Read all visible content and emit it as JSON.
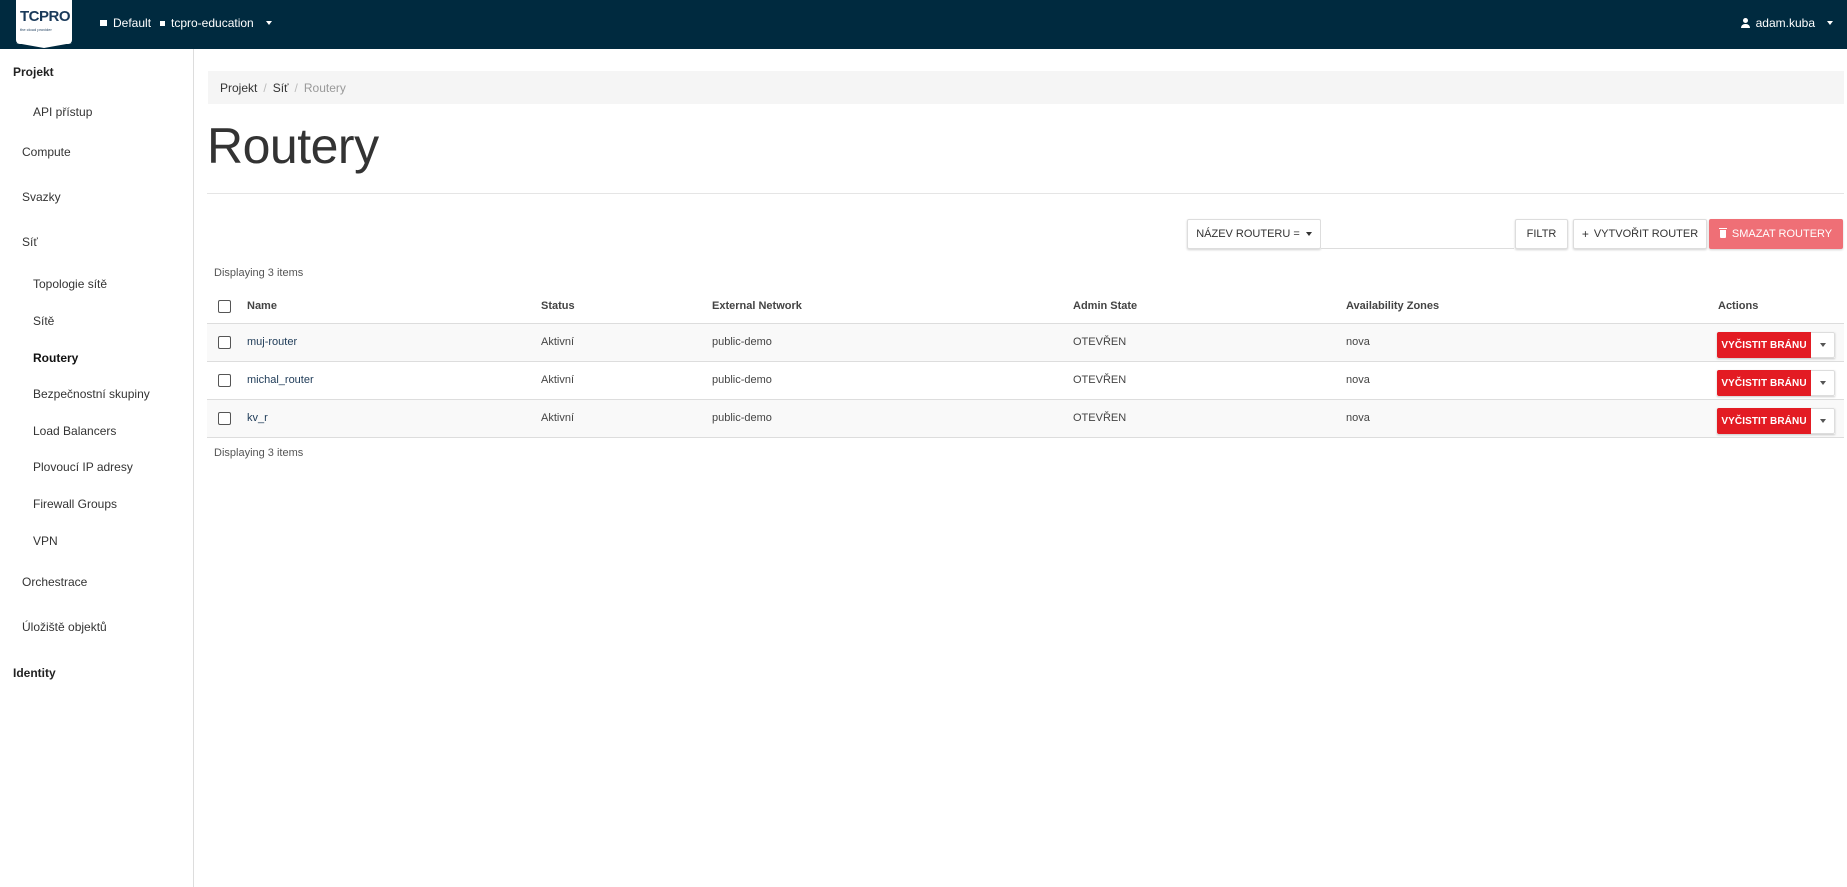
{
  "colors": {
    "topbar": "#002a3f",
    "danger": "#e31b23",
    "danger_light": "#ef6f76"
  },
  "header": {
    "logo_text": "TCPRO",
    "logo_tagline": "the cloud provider",
    "domain": "Default",
    "project": "tcpro-education",
    "user": "adam.kuba"
  },
  "sidebar": {
    "project_label": "Projekt",
    "api": "API přístup",
    "compute": "Compute",
    "volumes": "Svazky",
    "network": "Síť",
    "net_items": [
      "Topologie sítě",
      "Sítě",
      "Routery",
      "Bezpečnostní skupiny",
      "Load Balancers",
      "Plovoucí IP adresy",
      "Firewall Groups",
      "VPN"
    ],
    "orchestration": "Orchestrace",
    "object_store": "Úložiště objektů",
    "identity": "Identity"
  },
  "breadcrumb": [
    "Projekt",
    "Síť",
    "Routery"
  ],
  "page_title": "Routery",
  "toolbar": {
    "filter_field": "NÁZEV ROUTERU =",
    "filter_value": "",
    "filter_button": "FILTR",
    "create_button": "VYTVOŘIT ROUTER",
    "delete_button": "SMAZAT ROUTERY"
  },
  "count_label": "Displaying 3 items",
  "table": {
    "columns": [
      "Name",
      "Status",
      "External Network",
      "Admin State",
      "Availability Zones",
      "Actions"
    ],
    "rows": [
      {
        "name": "muj-router",
        "status": "Aktivní",
        "external_network": "public-demo",
        "admin_state": "OTEVŘEN",
        "az": "nova",
        "action": "VYČISTIT BRÁNU"
      },
      {
        "name": "michal_router",
        "status": "Aktivní",
        "external_network": "public-demo",
        "admin_state": "OTEVŘEN",
        "az": "nova",
        "action": "VYČISTIT BRÁNU"
      },
      {
        "name": "kv_r",
        "status": "Aktivní",
        "external_network": "public-demo",
        "admin_state": "OTEVŘEN",
        "az": "nova",
        "action": "VYČISTIT BRÁNU"
      }
    ]
  }
}
